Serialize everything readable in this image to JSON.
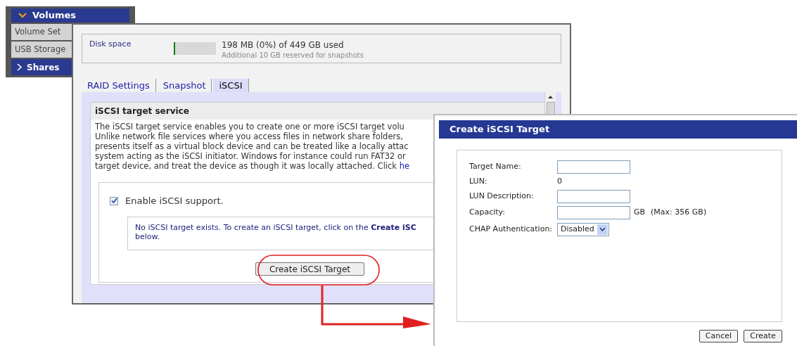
{
  "sidebar": {
    "header": {
      "label": "Volumes",
      "expanded": true
    },
    "items": [
      {
        "label": "Volume Set",
        "selected": false
      },
      {
        "label": "USB Storage",
        "selected": false
      },
      {
        "label": "Shares",
        "selected": true
      }
    ]
  },
  "main_window": {
    "disk_space": {
      "label": "Disk space",
      "level": 0.04,
      "usage": "198 MB (0%) of 449 GB used",
      "note": "Additional 10 GB reserved for snapshots"
    },
    "tabs": [
      {
        "label": "RAID Settings",
        "selected": false
      },
      {
        "label": "Snapshot",
        "selected": false
      },
      {
        "label": "iSCSI",
        "selected": true
      }
    ],
    "section_title": "iSCSI target service",
    "description_lines": [
      "The iSCSI target service enables you to create one or more iSCSI target volu",
      "Unlike network file services where you access files in network share folders,",
      "presents itself as a virtual block device and can be treated like a locally attac",
      "system acting as the iSCSI initiator. Windows for instance could run FAT32 or",
      "target device, and treat the device as though it was locally attached. Click "
    ],
    "description_link": "he",
    "enable_checkbox": {
      "label": "Enable iSCSI support.",
      "checked": true
    },
    "info_lines": [
      "No iSCSI target exists. To create an iSCSI target, click on the **Create iSC**",
      "below."
    ],
    "create_button": "Create iSCSI Target"
  },
  "dialog": {
    "title": "Create iSCSI Target",
    "fields": [
      {
        "kind": "input",
        "label": "Target Name:"
      },
      {
        "kind": "text",
        "label": "LUN:",
        "value": "0"
      },
      {
        "kind": "input",
        "label": "LUN Description:"
      },
      {
        "kind": "input",
        "label": "Capacity:",
        "suffix": "GB",
        "note": "(Max: 356 GB)"
      },
      {
        "kind": "select",
        "label": "CHAP Authentication:",
        "value": "Disabled"
      }
    ],
    "buttons": [
      "Cancel",
      "Create"
    ]
  }
}
